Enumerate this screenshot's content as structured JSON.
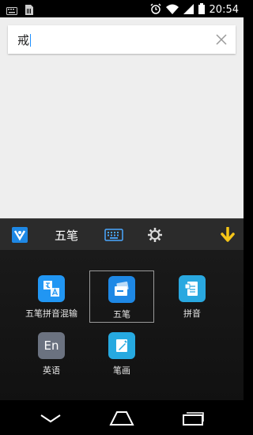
{
  "status_bar": {
    "time": "20:54",
    "icons": [
      "keyboard-icon",
      "sim-card-icon",
      "alarm-icon",
      "wifi-icon",
      "signal-icon",
      "battery-icon"
    ]
  },
  "search": {
    "value": "戒",
    "clear_icon": "close-icon"
  },
  "toolbar": {
    "app_icon": "input-method-logo-icon",
    "current_method": "五笔",
    "keyboard_icon": "keyboard-icon",
    "settings_icon": "gear-icon",
    "hide_icon": "arrow-down-icon",
    "hide_color": "#f5c518"
  },
  "methods": [
    {
      "label": "五笔拼音混输",
      "icon": "translate-icon",
      "icon_text": "A",
      "color": "#2196f3",
      "selected": false
    },
    {
      "label": "五笔",
      "icon": "keyboard-cards-icon",
      "icon_text": "",
      "color": "#1e88e5",
      "selected": true
    },
    {
      "label": "拼音",
      "icon": "document-icon",
      "icon_text": "",
      "color": "#29a8e0",
      "selected": false
    },
    {
      "label": "英语",
      "icon": "english-icon",
      "icon_text": "En",
      "color": "#6b7280",
      "selected": false
    },
    {
      "label": "笔画",
      "icon": "stroke-icon",
      "icon_text": "",
      "color": "#26a9e0",
      "selected": false
    }
  ],
  "nav": {
    "back_icon": "back-icon",
    "home_icon": "home-icon",
    "recents_icon": "recents-icon"
  }
}
